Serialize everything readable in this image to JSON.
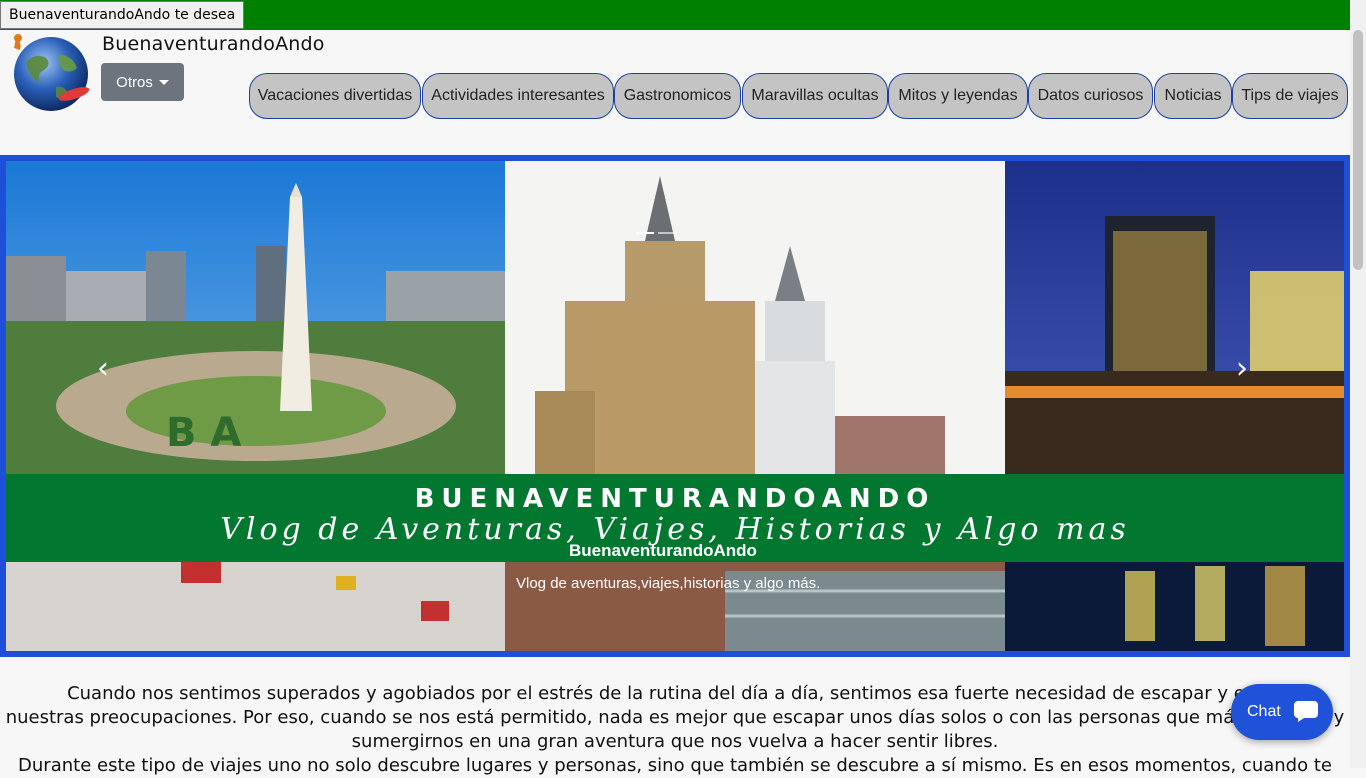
{
  "topbar": {
    "marquee_text": "BuenaventurandoAndo te desea"
  },
  "header": {
    "site_title": "BuenaventurandoAndo",
    "logo_text": "Buenaventurandoando",
    "otros_label": "Otros"
  },
  "nav": [
    {
      "label": "Vacaciones divertidas"
    },
    {
      "label": "Actividades interesantes"
    },
    {
      "label": "Gastronomicos"
    },
    {
      "label": "Maravillas ocultas"
    },
    {
      "label": "Mitos y leyendas"
    },
    {
      "label": "Datos curiosos"
    },
    {
      "label": "Noticias"
    },
    {
      "label": "Tips de viajes"
    }
  ],
  "carousel": {
    "prev_icon": "chevron-left-icon",
    "next_icon": "chevron-right-icon",
    "prev_glyph": "‹",
    "next_glyph": "›",
    "banner_title": "BUENAVENTURANDOANDO",
    "banner_subtitle": "Vlog de Aventuras, Viajes, Historias y Algo mas",
    "caption_title": "BuenaventurandoAndo",
    "caption_text": "Vlog de aventuras,viajes,historias y algo más."
  },
  "intro": {
    "line1": "Cuando nos sentimos superados y agobiados por el estrés de la rutina del día a día, sentimos esa fuerte necesidad de escapar y evadi",
    "line2": "nuestras preocupaciones. Por eso, cuando se nos está permitido, nada es mejor que escapar unos días solos o con las personas que más",
    "line2_end": "y",
    "line3": "sumergirnos en una gran aventura que nos vuelva a hacer sentir libres.",
    "line4": "Durante este tipo de viajes uno no solo descubre lugares y personas, sino que también se descubre a sí mismo. Es en esos momentos, cuando te"
  },
  "chat": {
    "label": "Chat",
    "icon": "chat-bubble-icon"
  },
  "colors": {
    "topbar": "#008000",
    "banner": "#02772f",
    "carousel_border": "#1e4fd8",
    "nav_pill_bg": "#c4c4c4",
    "nav_pill_border": "#1a3fa0",
    "otros_btn": "#6c757d",
    "chat_btn": "#1f52d8"
  }
}
